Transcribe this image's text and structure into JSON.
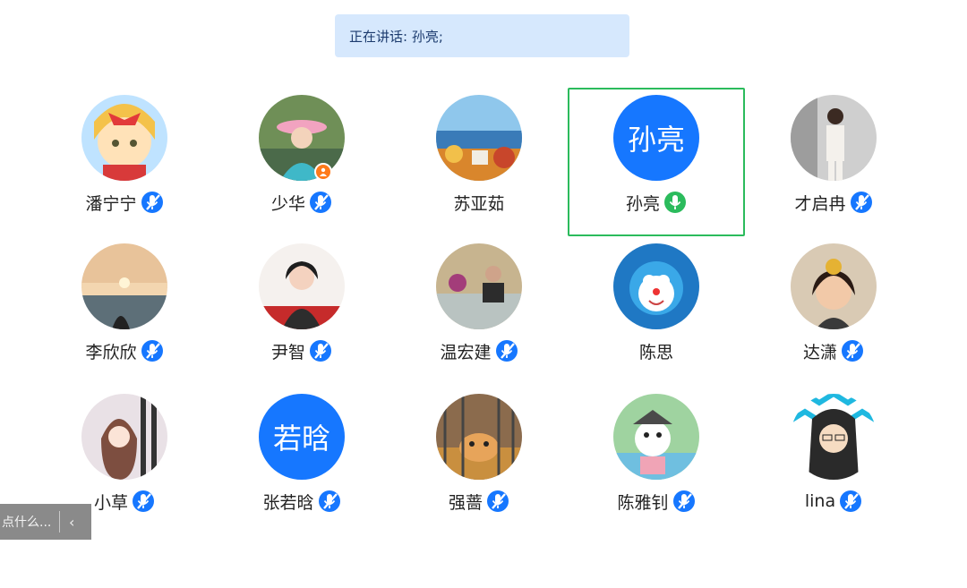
{
  "speaking_banner": {
    "text": "正在讲话: 孙亮;"
  },
  "participants": [
    {
      "name": "潘宁宁",
      "mic": "muted",
      "avatar": "photo"
    },
    {
      "name": "少华",
      "mic": "muted",
      "avatar": "photo",
      "host": true
    },
    {
      "name": "苏亚茹",
      "mic": "none",
      "avatar": "photo"
    },
    {
      "name": "孙亮",
      "mic": "speaking",
      "avatar": "text",
      "avatar_text": "孙亮",
      "active": true
    },
    {
      "name": "才启冉",
      "mic": "muted",
      "avatar": "photo"
    },
    {
      "name": "李欣欣",
      "mic": "muted",
      "avatar": "photo"
    },
    {
      "name": "尹智",
      "mic": "muted",
      "avatar": "photo"
    },
    {
      "name": "温宏建",
      "mic": "muted",
      "avatar": "photo"
    },
    {
      "name": "陈思",
      "mic": "none",
      "avatar": "photo"
    },
    {
      "name": "达潇",
      "mic": "muted",
      "avatar": "photo"
    },
    {
      "name": "小草",
      "mic": "muted",
      "avatar": "photo"
    },
    {
      "name": "张若晗",
      "mic": "muted",
      "avatar": "text",
      "avatar_text": "若晗"
    },
    {
      "name": "强蔷",
      "mic": "muted",
      "avatar": "photo"
    },
    {
      "name": "陈雅钊",
      "mic": "muted",
      "avatar": "photo"
    },
    {
      "name": "lina",
      "mic": "muted",
      "avatar": "photo"
    }
  ],
  "chat_bar": {
    "placeholder": "点什么...",
    "collapse_icon": "chevron-left-icon"
  },
  "colors": {
    "accent": "#1677ff",
    "active_border": "#2bbb5c",
    "banner_bg": "#d6e8fd",
    "speaking_mic": "#2bbb5c",
    "host_badge": "#ff7a1a"
  }
}
